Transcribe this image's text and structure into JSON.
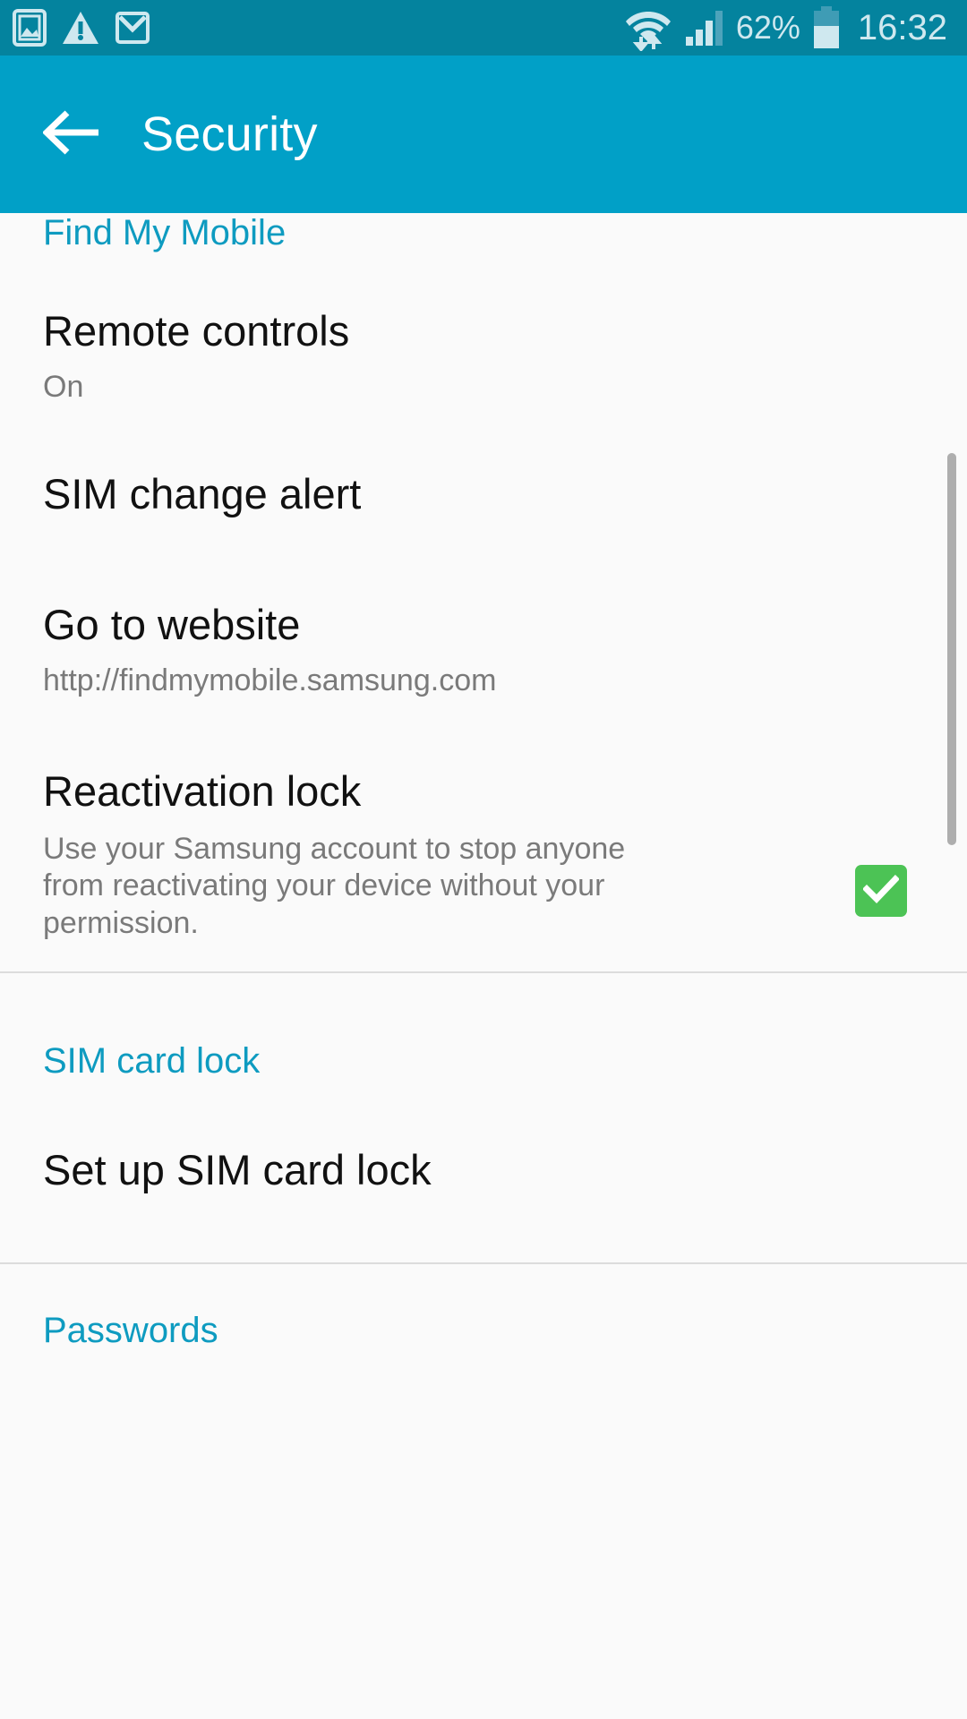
{
  "status_bar": {
    "icons_left": [
      "image-icon",
      "warning-triangle-icon",
      "gmail-icon"
    ],
    "wifi_icon": "wifi-with-transfer-arrows-icon",
    "signal_icon": "cellular-signal-icon",
    "battery_percent": "62%",
    "battery_icon": "battery-icon",
    "time": "16:32",
    "background_color": "#04839e",
    "foreground_color": "#cfe8ef"
  },
  "app_bar": {
    "back_icon": "back-arrow-icon",
    "title": "Security",
    "background_color": "#01a0c7",
    "text_color": "#ffffff"
  },
  "theme": {
    "accent": "#0e9bc0",
    "page_background": "#fafafa",
    "primary_text": "#111111",
    "secondary_text": "#7a7a7a",
    "divider": "#dcdcdc",
    "checkbox_green": "#4cc355",
    "scrollbar": "#aeaeae"
  },
  "sections": [
    {
      "header": "Find My Mobile",
      "items": [
        {
          "title": "Remote controls",
          "subtitle": "On"
        },
        {
          "title": "SIM change alert",
          "subtitle": ""
        },
        {
          "title": "Go to website",
          "subtitle": "http://findmymobile.samsung.com"
        },
        {
          "title": "Reactivation lock",
          "subtitle": "Use your Samsung account to stop anyone from reactivating your device without your permission.",
          "checkbox_checked": true
        }
      ]
    },
    {
      "header": "SIM card lock",
      "items": [
        {
          "title": "Set up SIM card lock",
          "subtitle": ""
        }
      ]
    },
    {
      "header": "Passwords",
      "items": []
    }
  ]
}
